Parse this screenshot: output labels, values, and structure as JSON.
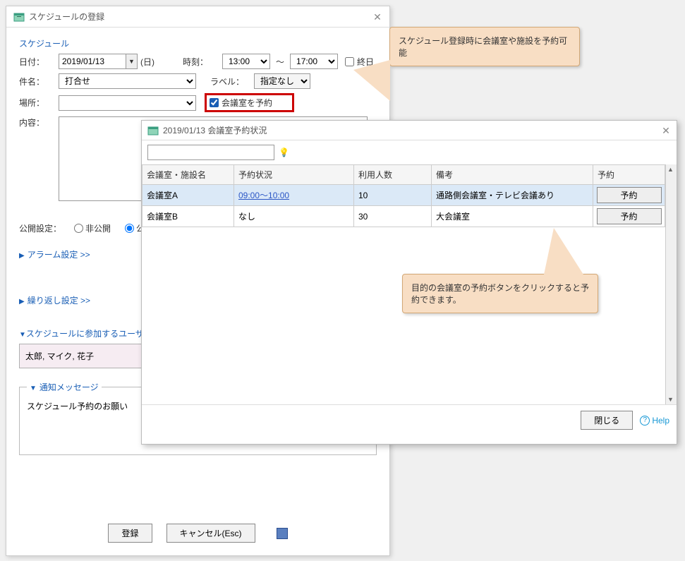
{
  "dialog": {
    "title": "スケジュールの登録",
    "section_title": "スケジュール",
    "labels": {
      "date": "日付：",
      "day_suffix": "(日)",
      "time": "時刻：",
      "tilde": "～",
      "allday": "終日",
      "subject": "件名：",
      "label": "ラベル：",
      "place": "場所：",
      "reserve_room": "会議室を予約",
      "content": "内容：",
      "publish": "公開設定：",
      "private": "非公開",
      "public_partial": "公"
    },
    "values": {
      "date": "2019/01/13",
      "time_start": "13:00",
      "time_end": "17:00",
      "subject": "打合せ",
      "label": "指定なし",
      "place": ""
    },
    "links": {
      "alarm": "アラーム設定 >>",
      "repeat": "繰り返し設定 >>"
    },
    "users_section": "スケジュールに参加するユーザ",
    "users": "太郎, マイク, 花子",
    "notify_section": "通知メッセージ",
    "notify_body": "スケジュール予約のお願い",
    "buttons": {
      "register": "登録",
      "cancel": "キャンセル(Esc)"
    }
  },
  "room_dialog": {
    "title": "2019/01/13 会議室予約状況",
    "headers": {
      "name": "会議室・施設名",
      "status": "予約状況",
      "capacity": "利用人数",
      "note": "備考",
      "reserve": "予約"
    },
    "rows": [
      {
        "name": "会議室A",
        "status": "09:00～10:00",
        "status_link": true,
        "capacity": "10",
        "note": "通路側会議室・テレビ会議あり"
      },
      {
        "name": "会議室B",
        "status": "なし",
        "status_link": false,
        "capacity": "30",
        "note": "大会議室"
      }
    ],
    "reserve_label": "予約",
    "close": "閉じる",
    "help": "Help"
  },
  "callouts": {
    "c1": "スケジュール登録時に会議室や施設を予約可能",
    "c2": "目的の会議室の予約ボタンをクリックすると予約できます。"
  }
}
